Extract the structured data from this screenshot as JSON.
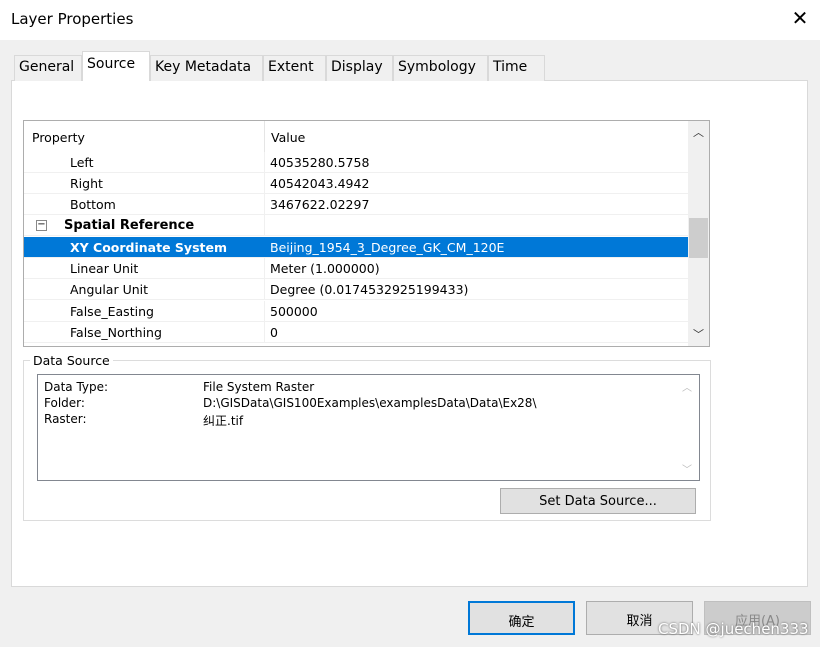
{
  "window": {
    "title": "Layer Properties"
  },
  "tabs": [
    {
      "label": "General"
    },
    {
      "label": "Source"
    },
    {
      "label": "Key Metadata"
    },
    {
      "label": "Extent"
    },
    {
      "label": "Display"
    },
    {
      "label": "Symbology"
    },
    {
      "label": "Time"
    }
  ],
  "grid": {
    "headers": {
      "property": "Property",
      "value": "Value"
    },
    "rows": [
      {
        "key": "Left",
        "value": "40535280.5758"
      },
      {
        "key": "Right",
        "value": "40542043.4942"
      },
      {
        "key": "Bottom",
        "value": "3467622.02297"
      },
      {
        "key": "Spatial Reference",
        "value": ""
      },
      {
        "key": "XY Coordinate System",
        "value": "Beijing_1954_3_Degree_GK_CM_120E"
      },
      {
        "key": "Linear Unit",
        "value": "Meter (1.000000)"
      },
      {
        "key": "Angular Unit",
        "value": "Degree (0.0174532925199433)"
      },
      {
        "key": "False_Easting",
        "value": "500000"
      },
      {
        "key": "False_Northing",
        "value": "0"
      }
    ],
    "expander": "−"
  },
  "data_source": {
    "label": "Data Source",
    "items": [
      {
        "key": "Data Type:",
        "value": "File System Raster"
      },
      {
        "key": "Folder:",
        "value": "D:\\GISData\\GIS100Examples\\examplesData\\Data\\Ex28\\"
      },
      {
        "key": "Raster:",
        "value": "纠正.tif"
      }
    ],
    "set_button": "Set Data Source..."
  },
  "buttons": {
    "ok": "确定",
    "cancel": "取消",
    "apply": "应用(A)"
  },
  "watermark": "CSDN @juechen333"
}
